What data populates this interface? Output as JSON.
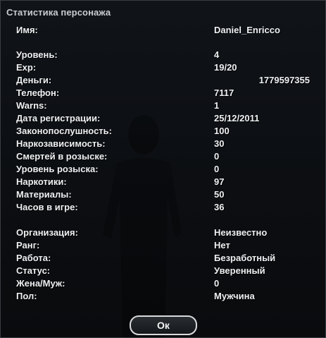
{
  "dialog": {
    "title": "Статистика персонажа",
    "ok_label": "Ок"
  },
  "stats": {
    "name": {
      "label": "Имя:",
      "value": "Daniel_Enricco"
    },
    "level": {
      "label": "Уровень:",
      "value": "4"
    },
    "exp": {
      "label": "Exp:",
      "value": "19/20"
    },
    "money": {
      "label": "Деньги:",
      "value": "1779597355"
    },
    "phone": {
      "label": "Телефон:",
      "value": "7117"
    },
    "warns": {
      "label": "Warns:",
      "value": "1"
    },
    "reg_date": {
      "label": "Дата регистрации:",
      "value": "25/12/2011"
    },
    "law": {
      "label": "Законопослушность:",
      "value": "100"
    },
    "drug_addict": {
      "label": "Наркозависимость:",
      "value": "30"
    },
    "wanted_deaths": {
      "label": "Смертей в розыске:",
      "value": "0"
    },
    "wanted_level": {
      "label": "Уровень розыска:",
      "value": "0"
    },
    "drugs": {
      "label": "Наркотики:",
      "value": "97"
    },
    "materials": {
      "label": "Материалы:",
      "value": "50"
    },
    "hours": {
      "label": "Часов в игре:",
      "value": "36"
    },
    "org": {
      "label": "Организация:",
      "value": "Неизвестно"
    },
    "rank": {
      "label": "Ранг:",
      "value": "Нет"
    },
    "job": {
      "label": "Работа:",
      "value": "Безработный"
    },
    "status": {
      "label": "Статус:",
      "value": "Уверенный"
    },
    "spouse": {
      "label": "Жена/Муж:",
      "value": "0"
    },
    "gender": {
      "label": "Пол:",
      "value": "Мужчина"
    }
  }
}
